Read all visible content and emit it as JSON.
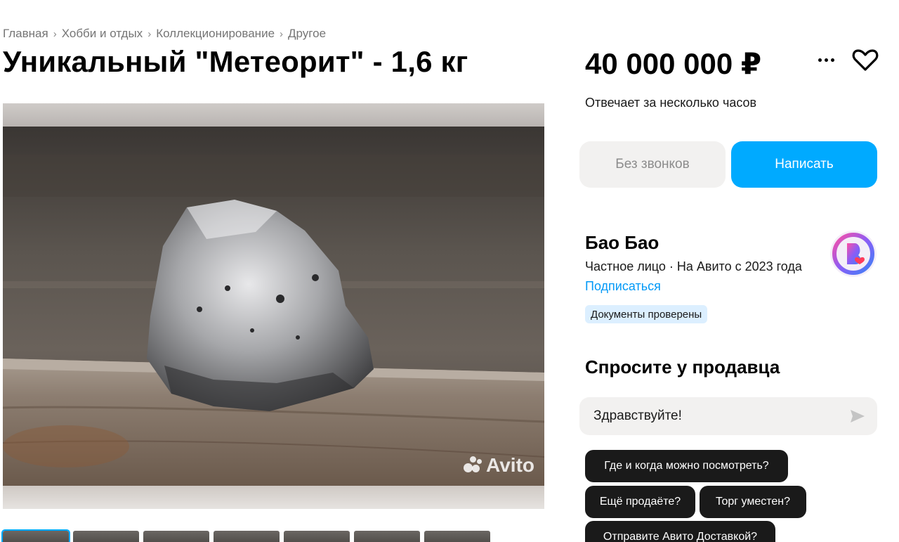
{
  "breadcrumbs": [
    "Главная",
    "Хобби и отдых",
    "Коллекционирование",
    "Другое"
  ],
  "listing": {
    "title": "Уникальный \"Метеорит\" - 1,6 кг",
    "price": "40 000 000 ₽",
    "response_time": "Отвечает за несколько часов"
  },
  "actions": {
    "no_calls_label": "Без звонков",
    "write_label": "Написать"
  },
  "seller": {
    "name": "Бао Бао",
    "meta": "Частное лицо · На Авито с 2023 года",
    "subscribe_label": "Подписаться",
    "docs_badge": "Документы проверены"
  },
  "ask": {
    "title": "Спросите у продавца",
    "message_value": "Здравствуйте!",
    "quick_questions": [
      "Где и когда можно посмотреть?",
      "Ещё продаёте?",
      "Торг уместен?",
      "Отправите Авито Доставкой?"
    ]
  },
  "gallery": {
    "watermark": "Avito",
    "thumbnail_count": 7
  },
  "colors": {
    "accent": "#00aaff",
    "link": "#0099f7",
    "badge_bg": "#dcefff",
    "chip_bg": "#1a1a1a"
  },
  "icons": [
    "more-dots-icon",
    "heart-icon",
    "send-arrow-icon",
    "avito-logo-icon"
  ]
}
